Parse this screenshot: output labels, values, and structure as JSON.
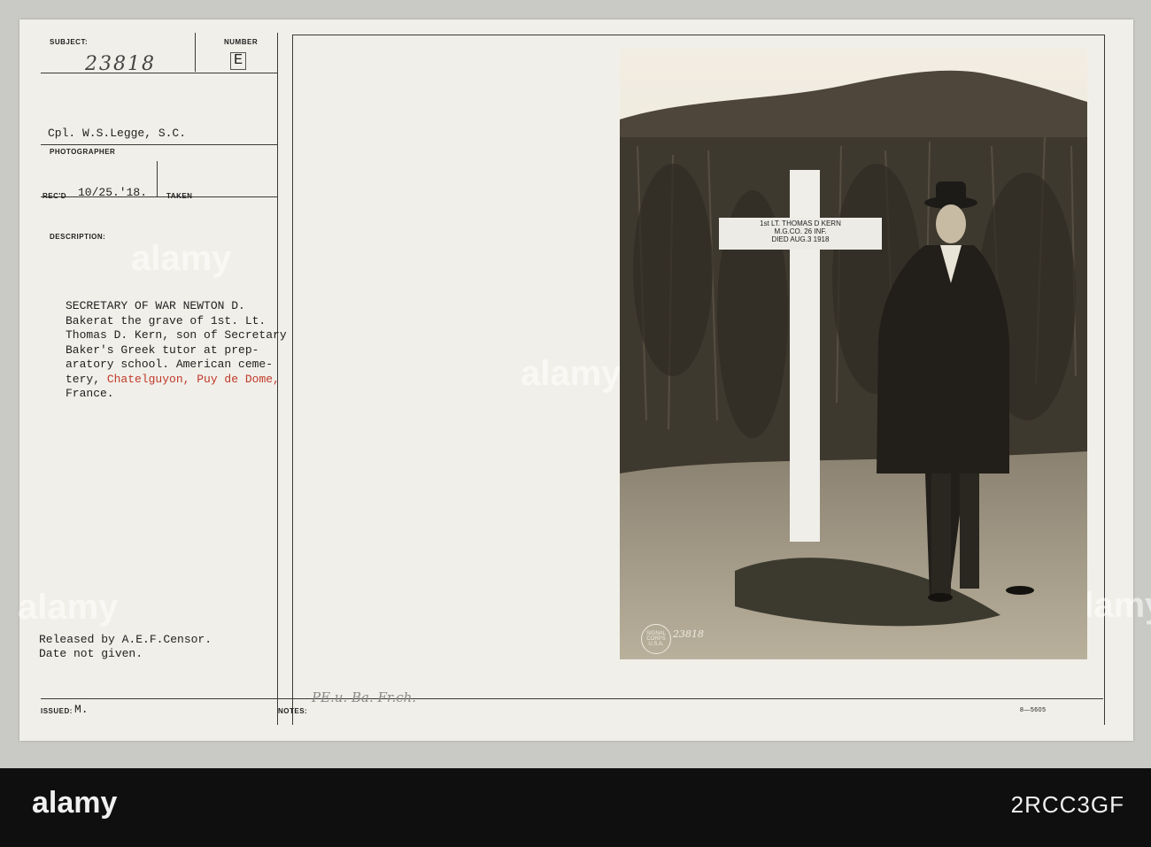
{
  "header": {
    "subject_label": "SUBJECT:",
    "subject_value": "23818",
    "number_label": "NUMBER",
    "number_value": "E",
    "photographer_value": "Cpl. W.S.Legge, S.C.",
    "photographer_label": "PHOTOGRAPHER",
    "recd_label": "REC'D",
    "recd_value": "10/25.'18.",
    "taken_label": "TAKEN",
    "description_label": "DESCRIPTION:"
  },
  "description": {
    "line1": "SECRETARY OF WAR NEWTON D.",
    "line2": "Bakerat the grave of 1st. Lt.",
    "line3": "Thomas D. Kern, son of Secretary",
    "line4": "Baker's Greek tutor at prep-",
    "line5": "aratory school. American ceme-",
    "line6_prefix": "tery, ",
    "line6_red": "Chatelguyon, Puy de Dome,",
    "line7": "France."
  },
  "release": {
    "line1": "Released by A.E.F.Censor.",
    "line2": "Date not given."
  },
  "footer": {
    "issued_label": "ISSUED:",
    "issued_value": "M.",
    "notes_label": "NOTES:",
    "notes_handwriting": "PE.u. Ba. Fr.ch.",
    "form_number": "8—5605"
  },
  "photo": {
    "sign_line1": "1st LT. THOMAS D KERN",
    "sign_line2": "M.G.CO. 26 INF.",
    "sign_line3": "DIED AUG.3 1918",
    "stamp_text": "SIGNAL CORPS U.S.A.",
    "stamp_number": "23818"
  },
  "stock_watermark": {
    "brand": "alamy",
    "image_id": "2RCC3GF"
  },
  "colors": {
    "paper": "#f1efe9",
    "background": "#c9c9c5",
    "stripe": "#0f0f0f",
    "highlight_text": "#c0392b"
  }
}
